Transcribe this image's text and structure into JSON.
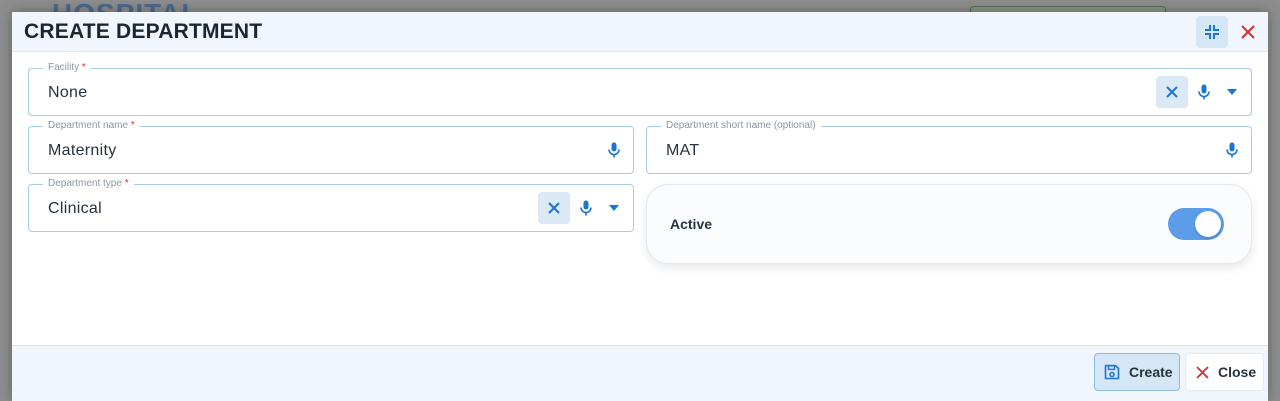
{
  "dialog": {
    "title": "CREATE DEPARTMENT"
  },
  "fields": {
    "facility": {
      "label": "Facility",
      "required_mark": "*",
      "value": "None"
    },
    "department_name": {
      "label": "Department name",
      "required_mark": "*",
      "value": "Maternity"
    },
    "department_short_name": {
      "label": "Department short name",
      "optional_note": "(optional)",
      "value": "MAT"
    },
    "department_type": {
      "label": "Department type",
      "required_mark": "*",
      "value": "Clinical"
    }
  },
  "active_toggle": {
    "label": "Active",
    "state": "on"
  },
  "footer": {
    "create_label": "Create",
    "close_label": "Close"
  },
  "colors": {
    "accent": "#1976d2",
    "close_red": "#d32f2f",
    "toggle_on": "#5b9de8"
  },
  "icons": [
    "collapse-icon",
    "close-icon",
    "clear-icon",
    "microphone-icon",
    "dropdown-arrow-icon",
    "save-icon"
  ]
}
